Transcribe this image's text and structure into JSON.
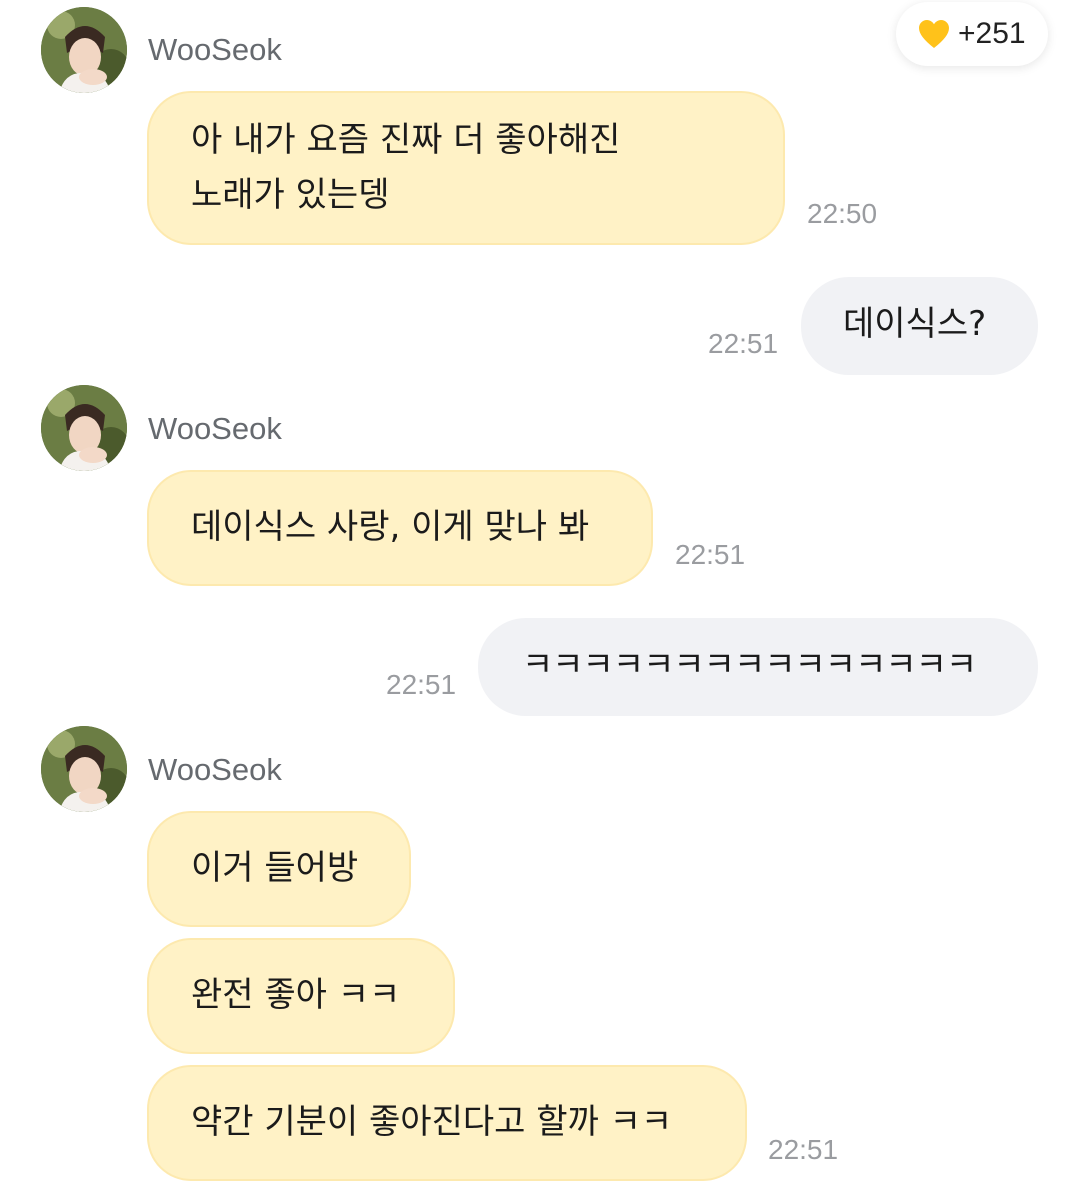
{
  "badge": {
    "icon": "heart-icon",
    "color": "#ffc21a",
    "count": "+251"
  },
  "conversation": [
    {
      "side": "incoming",
      "sender": "WooSeok",
      "messages": [
        {
          "lines": [
            "아 내가 요즘 진짜 더 좋아해진",
            "노래가 있는뎅"
          ],
          "time": "22:50"
        }
      ]
    },
    {
      "side": "outgoing",
      "messages": [
        {
          "lines": [
            "데이식스?"
          ],
          "time": "22:51"
        }
      ]
    },
    {
      "side": "incoming",
      "sender": "WooSeok",
      "messages": [
        {
          "lines": [
            "데이식스 사랑, 이게 맞나 봐"
          ],
          "time": "22:51"
        }
      ]
    },
    {
      "side": "outgoing",
      "messages": [
        {
          "lines": [
            "ㅋㅋㅋㅋㅋㅋㅋㅋㅋㅋㅋㅋㅋㅋㅋ"
          ],
          "time": "22:51"
        }
      ]
    },
    {
      "side": "incoming",
      "sender": "WooSeok",
      "messages": [
        {
          "lines": [
            "이거 들어방"
          ]
        },
        {
          "lines": [
            "완전 좋아 ㅋㅋ"
          ]
        },
        {
          "lines": [
            "약간 기분이 좋아진다고 할까 ㅋㅋ"
          ],
          "time": "22:51"
        }
      ]
    }
  ],
  "colors": {
    "incoming_bubble": "#fff2c6",
    "outgoing_bubble": "#f1f2f5",
    "timestamp": "#9a9ca0",
    "sender_name": "#666a6f"
  }
}
